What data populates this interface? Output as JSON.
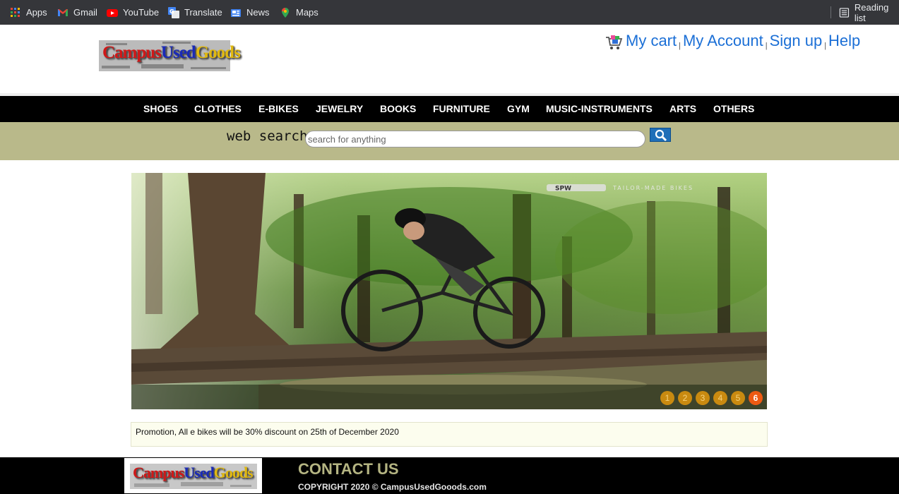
{
  "bookmarks": {
    "items": [
      {
        "label": "Apps",
        "icon": "apps-grid-icon"
      },
      {
        "label": "Gmail",
        "icon": "gmail-icon"
      },
      {
        "label": "YouTube",
        "icon": "youtube-icon"
      },
      {
        "label": "Translate",
        "icon": "translate-icon"
      },
      {
        "label": "News",
        "icon": "news-icon"
      },
      {
        "label": "Maps",
        "icon": "maps-icon"
      }
    ],
    "reading_list": "Reading list"
  },
  "logo": {
    "part1": "Campus",
    "part2": "Used",
    "part3": "Goods"
  },
  "account": {
    "cart": "My cart",
    "account": "My Account",
    "signup": "Sign up",
    "help": "Help",
    "separator": "|"
  },
  "categories": [
    "SHOES",
    "CLOTHES",
    "E-BIKES",
    "JEWELRY",
    "BOOKS",
    "FURNITURE",
    "GYM",
    "MUSIC-INSTRUMENTS",
    "ARTS",
    "OTHERS"
  ],
  "search": {
    "label": "web search",
    "placeholder": "search for anything"
  },
  "banner": {
    "brand_badge": "SPW",
    "brand_tag": "TAILOR-MADE BIKES",
    "pages": [
      "1",
      "2",
      "3",
      "4",
      "5",
      "6"
    ],
    "active_page": "6"
  },
  "promo": {
    "text": "Promotion, All e bikes will be 30% discount on 25th of December 2020"
  },
  "footer": {
    "contact": "CONTACT US",
    "copyright": "COPYRIGHT 2020 © CampusUsedGooods.com"
  },
  "colors": {
    "nav_bg": "#000000",
    "search_band": "#b9b98a",
    "link": "#1b6fd6",
    "pager": "#c98a10",
    "pager_active": "#ee5a12",
    "contact_heading": "#b4b482"
  }
}
